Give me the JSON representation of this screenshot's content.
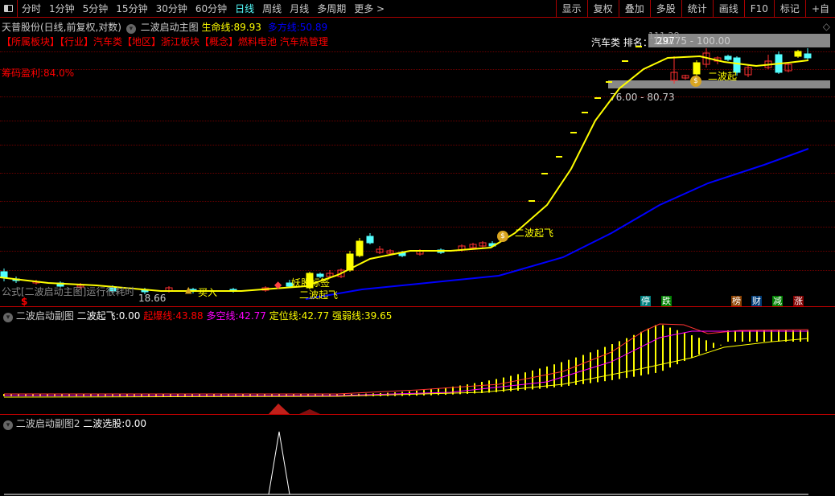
{
  "toolbar": {
    "periods": [
      "分时",
      "1分钟",
      "5分钟",
      "15分钟",
      "30分钟",
      "60分钟",
      "日线",
      "周线",
      "月线",
      "多周期",
      "更多 >"
    ],
    "active": "日线",
    "tools": [
      "显示",
      "复权",
      "叠加",
      "多股",
      "统计",
      "画线",
      "F10",
      "标记",
      "+自"
    ]
  },
  "main": {
    "title": "天普股份(日线,前复权,对数)",
    "indicator": "二波启动主图",
    "life_line_label": "生命线:",
    "life_line": "89.93",
    "bull_line_label": "多方线:",
    "bull_line": "50.89",
    "sector_info": "【所属板块】【行业】汽车类【地区】浙江板块【概念】燃料电池 汽车热管理",
    "chip_profit": "筹码盈利:84.0%",
    "rank_label": "汽车类 排名：",
    "rank": "297",
    "upper_range": "100.75 - 100.00",
    "lower_range": "76.00 - 80.73",
    "high_label": "111.28",
    "low_label": "18.66",
    "signals": {
      "second_wave": "二波起飞",
      "second_wave_short": "二波起",
      "buy": "买入",
      "demon_tag": "妖股标签"
    },
    "formula_note": "公式[二波启动主图]运行很耗时",
    "chips": [
      {
        "text": "停",
        "color": "#008080"
      },
      {
        "text": "跌",
        "color": "#008000"
      },
      {
        "text": "榜",
        "color": "#8b4000"
      },
      {
        "text": "财",
        "color": "#003c78"
      },
      {
        "text": "减",
        "color": "#008000"
      },
      {
        "text": "涨",
        "color": "#800000"
      }
    ],
    "colors": {
      "life": "#ffff00",
      "bull": "#0000ff",
      "up": "#ff3030",
      "down": "#54ffff"
    }
  },
  "sub1": {
    "title": "二波启动副图",
    "fly_label": "二波起飞:",
    "fly": "0.00",
    "burst_label": "起爆线:",
    "burst": "43.88",
    "ls_label": "多空线:",
    "ls": "42.77",
    "pos_label": "定位线:",
    "pos": "42.77",
    "strength_label": "强弱线:",
    "strength": "39.65"
  },
  "sub2": {
    "title": "二波启动副图2",
    "pick_label": "二波选股:",
    "pick": "0.00"
  }
}
